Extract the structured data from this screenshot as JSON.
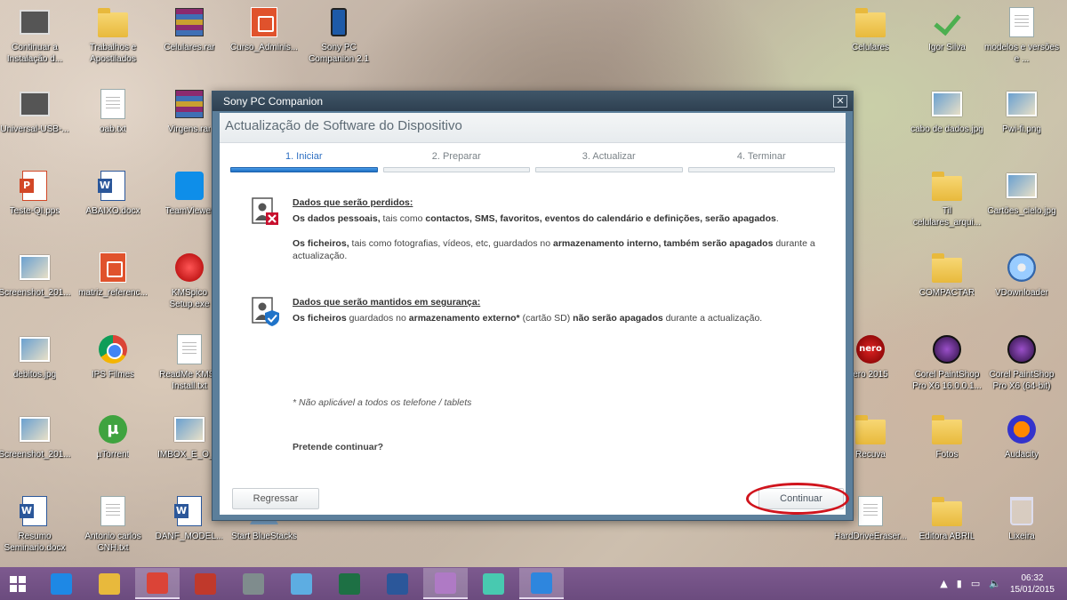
{
  "desktop": {
    "icons": [
      {
        "label": "Continuar a Instalação d...",
        "kind": "setup"
      },
      {
        "label": "Trabalhos e Apostilados",
        "kind": "folder"
      },
      {
        "label": "Celulares.rar",
        "kind": "rar"
      },
      {
        "label": "Curso_Adminis...",
        "kind": "orange-doc"
      },
      {
        "label": "Sony PC Companion 2.1",
        "kind": "phone"
      },
      {
        "label": "Universal-USB-...",
        "kind": "pc"
      },
      {
        "label": "oab.txt",
        "kind": "doc"
      },
      {
        "label": "Virgens.rar",
        "kind": "rar"
      },
      {
        "label": "Teste-QI.pps",
        "kind": "ppt"
      },
      {
        "label": "ABAIXO.docx",
        "kind": "word"
      },
      {
        "label": "TeamViewer",
        "kind": "teal"
      },
      {
        "label": "Screenshot_201...",
        "kind": "img"
      },
      {
        "label": "matriz_referenc...",
        "kind": "orange-doc"
      },
      {
        "label": "KMSpico Setup.exe",
        "kind": "red"
      },
      {
        "label": "debitos.jpg",
        "kind": "img"
      },
      {
        "label": "IPS Filmes",
        "kind": "chrome"
      },
      {
        "label": "ReadMe KMSp Install.txt",
        "kind": "doc"
      },
      {
        "label": "Screenshot_201...",
        "kind": "img"
      },
      {
        "label": "µTorrent",
        "kind": "green"
      },
      {
        "label": "IMBOX_E_O_...",
        "kind": "img"
      },
      {
        "label": "Resumo Seminario.docx",
        "kind": "word"
      },
      {
        "label": "Antonio carlos CNH.txt",
        "kind": "doc"
      },
      {
        "label": "DANF_MODEL...",
        "kind": "word"
      },
      {
        "label": "Start BlueStacks",
        "kind": "tri"
      },
      {
        "label": "Celulares",
        "kind": "folder"
      },
      {
        "label": "Igor Silva",
        "kind": "check"
      },
      {
        "label": "modelos e versões e ...",
        "kind": "doc"
      },
      {
        "label": "cabo de dados.jpg",
        "kind": "img"
      },
      {
        "label": "Pwi-fi.png",
        "kind": "img"
      },
      {
        "label": "Til celulares_arqui...",
        "kind": "folder"
      },
      {
        "label": "Cartões_cielo.jpg",
        "kind": "img"
      },
      {
        "label": "COMPACTAR",
        "kind": "folder"
      },
      {
        "label": "VDownloader",
        "kind": "disc"
      },
      {
        "label": "ero 2015",
        "kind": "nero"
      },
      {
        "label": "Corel PaintShop Pro X6 16.0.0.1...",
        "kind": "corel"
      },
      {
        "label": "Corel PaintShop Pro X6 (64-bit)",
        "kind": "corel"
      },
      {
        "label": "Recuva",
        "kind": "folder"
      },
      {
        "label": "Fotos",
        "kind": "folder"
      },
      {
        "label": "Audacity",
        "kind": "audacity"
      },
      {
        "label": "HardDriveEraser...",
        "kind": "doc"
      },
      {
        "label": "Editora ABRIL",
        "kind": "folder"
      },
      {
        "label": "Lixeira",
        "kind": "bin"
      }
    ]
  },
  "dialog": {
    "window_title": "Sony PC Companion",
    "close_glyph": "✕",
    "heading": "Actualização de Software do Dispositivo",
    "steps": [
      {
        "label": "1. Iniciar",
        "active": true
      },
      {
        "label": "2. Preparar",
        "active": false
      },
      {
        "label": "3. Actualizar",
        "active": false
      },
      {
        "label": "4. Terminar",
        "active": false
      }
    ],
    "lost": {
      "title": "Dados que serão perdidos:",
      "line1_b1": "Os dados pessoais,",
      "line1_t1": " tais como ",
      "line1_b2": "contactos, SMS, favoritos, eventos do calendário e definições, serão apagados",
      "line1_t2": ".",
      "line2_b1": "Os ficheiros,",
      "line2_t1": " tais como fotografias, vídeos, etc, guardados no ",
      "line2_b2": "armazenamento interno, também serão apagados",
      "line2_t2": " durante a actualização."
    },
    "kept": {
      "title": "Dados que serão mantidos em segurança:",
      "b1": "Os ficheiros",
      "t1": " guardados no ",
      "b2": "armazenamento externo*",
      "t2": " (cartão SD) ",
      "b3": "não serão apagados",
      "t3": " durante a actualização."
    },
    "note": "* Não aplicável a todos os telefone / tablets",
    "question": "Pretende continuar?",
    "back_button": "Regressar",
    "continue_button": "Continuar",
    "highlight_color": "#d0141d"
  },
  "taskbar": {
    "apps": [
      {
        "name": "ie",
        "color": "#1e88e5",
        "active": false
      },
      {
        "name": "explorer",
        "color": "#e8b93c",
        "active": false
      },
      {
        "name": "chrome",
        "color": "#db4437",
        "active": true
      },
      {
        "name": "app-red",
        "color": "#c0392b",
        "active": false
      },
      {
        "name": "calculator",
        "color": "#7f8c8d",
        "active": false
      },
      {
        "name": "notes",
        "color": "#5dade2",
        "active": false
      },
      {
        "name": "excel",
        "color": "#1d7044",
        "active": false
      },
      {
        "name": "word",
        "color": "#2b579a",
        "active": false
      },
      {
        "name": "paint",
        "color": "#af7ac5",
        "active": true
      },
      {
        "name": "remote",
        "color": "#48c9b0",
        "active": false
      },
      {
        "name": "sony-companion",
        "color": "#2e86de",
        "active": true
      }
    ],
    "tray_icons": [
      "▲",
      "▮",
      "▭",
      "🔈"
    ],
    "time": "06:32",
    "date": "15/01/2015"
  }
}
